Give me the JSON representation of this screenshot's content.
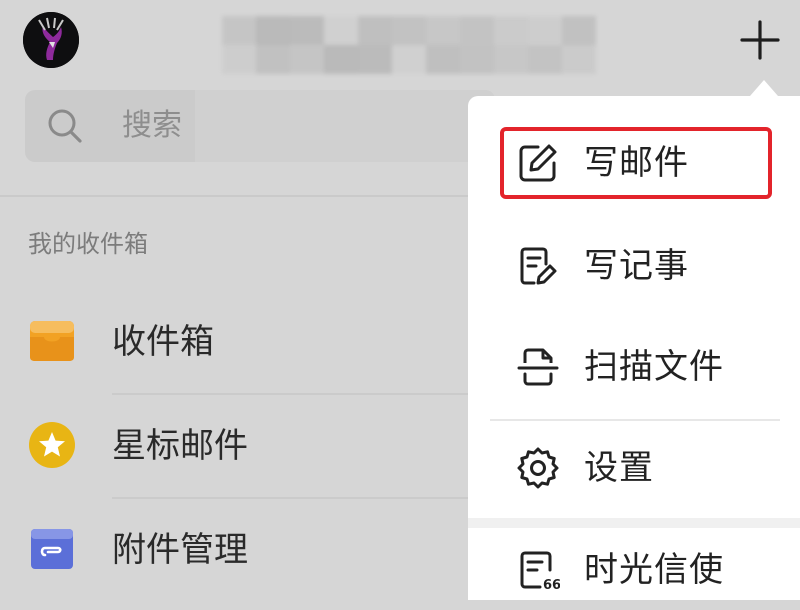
{
  "header": {
    "avatar": "deer-logo-avatar",
    "account_name_blurred": true,
    "add_icon": "plus-icon"
  },
  "search": {
    "icon": "search-icon",
    "placeholder": "搜索"
  },
  "mailboxes": {
    "section_title": "我的收件箱",
    "items": [
      {
        "label": "收件箱",
        "icon": "inbox-tray-icon",
        "color": "#f2a224"
      },
      {
        "label": "星标邮件",
        "icon": "star-badge-icon",
        "color": "#e8b514"
      },
      {
        "label": "附件管理",
        "icon": "attachment-folder-icon",
        "color": "#5b6fd8"
      }
    ]
  },
  "popup_menu": {
    "items": [
      {
        "label": "写邮件",
        "icon": "compose-edit-icon",
        "highlighted": true
      },
      {
        "label": "写记事",
        "icon": "note-edit-icon"
      },
      {
        "label": "扫描文件",
        "icon": "scan-document-icon"
      },
      {
        "label": "设置",
        "icon": "gear-icon"
      },
      {
        "label": "时光信使",
        "icon": "time-letter-icon"
      }
    ]
  },
  "colors": {
    "highlight_border": "#e3242b",
    "dimmed_background": "#d6d6d6",
    "menu_background": "#ffffff"
  }
}
